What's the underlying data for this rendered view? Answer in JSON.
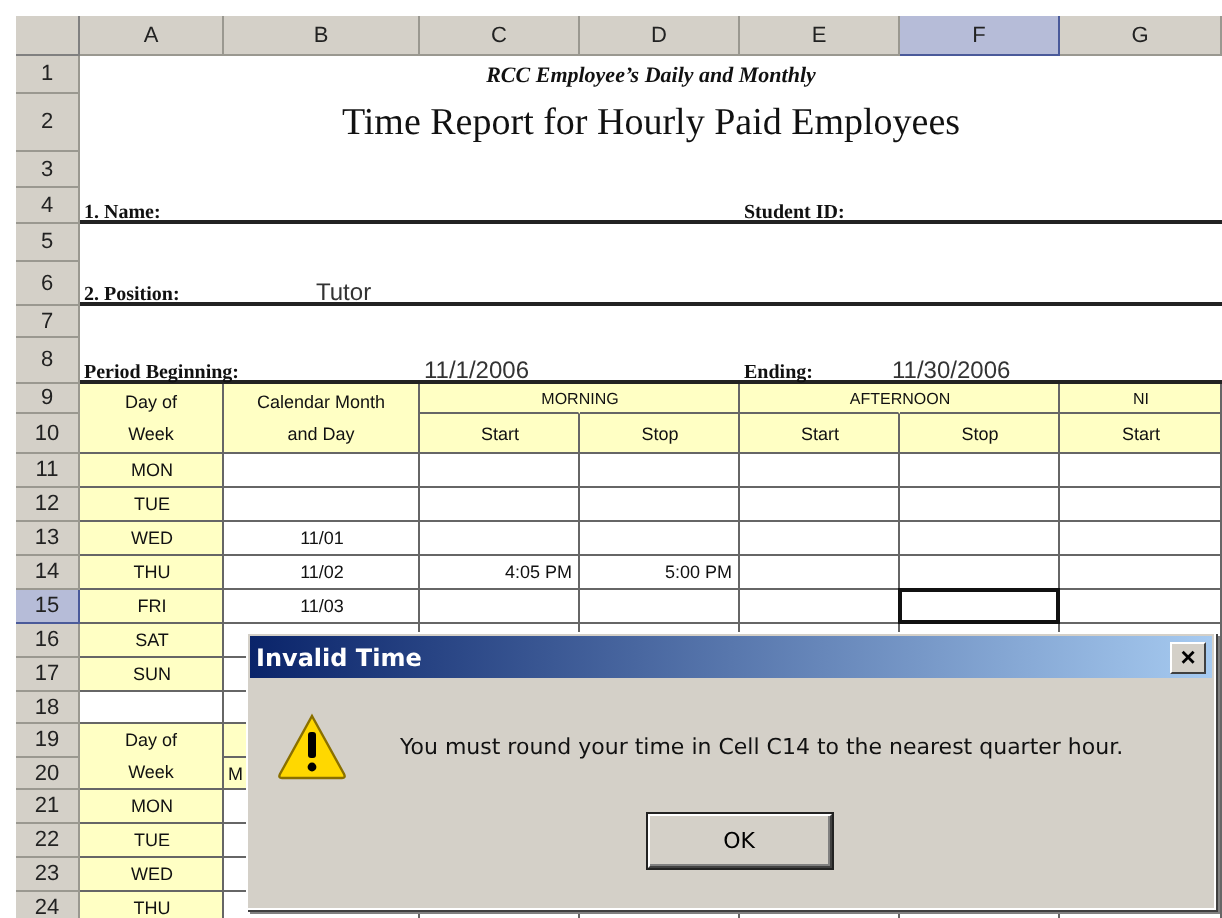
{
  "column_headers": [
    {
      "label": "A",
      "selected": false
    },
    {
      "label": "B",
      "selected": false
    },
    {
      "label": "C",
      "selected": false
    },
    {
      "label": "D",
      "selected": false
    },
    {
      "label": "E",
      "selected": false
    },
    {
      "label": "F",
      "selected": true
    },
    {
      "label": "G",
      "selected": false
    }
  ],
  "row_headers": [
    {
      "label": "1",
      "selected": false
    },
    {
      "label": "2",
      "selected": false
    },
    {
      "label": "3",
      "selected": false
    },
    {
      "label": "4",
      "selected": false
    },
    {
      "label": "5",
      "selected": false
    },
    {
      "label": "6",
      "selected": false
    },
    {
      "label": "7",
      "selected": false
    },
    {
      "label": "8",
      "selected": false
    },
    {
      "label": "9",
      "selected": false
    },
    {
      "label": "10",
      "selected": false
    },
    {
      "label": "11",
      "selected": false
    },
    {
      "label": "12",
      "selected": false
    },
    {
      "label": "13",
      "selected": false
    },
    {
      "label": "14",
      "selected": false
    },
    {
      "label": "15",
      "selected": true
    },
    {
      "label": "16",
      "selected": false
    },
    {
      "label": "17",
      "selected": false
    },
    {
      "label": "18",
      "selected": false
    },
    {
      "label": "19",
      "selected": false
    },
    {
      "label": "20",
      "selected": false
    },
    {
      "label": "21",
      "selected": false
    },
    {
      "label": "22",
      "selected": false
    },
    {
      "label": "23",
      "selected": false
    },
    {
      "label": "24",
      "selected": false
    }
  ],
  "form": {
    "title_line1": "RCC Employee’s Daily and Monthly",
    "title_line2": "Time Report for Hourly Paid Employees",
    "name_label": "1. Name:",
    "student_id_label": "Student ID:",
    "position_label": "2. Position:",
    "position_value": "Tutor",
    "period_beginning_label": "Period Beginning:",
    "period_beginning_value": "11/1/2006",
    "ending_label": "Ending:",
    "ending_value": "11/30/2006"
  },
  "table": {
    "day_header": "Day of Week",
    "date_header": "Calendar Month and Day",
    "groups": [
      "MORNING",
      "AFTERNOON",
      "NI"
    ],
    "subheaders": [
      "Start",
      "Stop",
      "Start",
      "Stop",
      "Start"
    ],
    "days": [
      {
        "day": "MON",
        "times": [
          {
            "selected": false
          },
          {
            "selected": false
          },
          {
            "selected": false
          },
          {
            "selected": false
          },
          {
            "selected": false
          }
        ]
      },
      {
        "day": "TUE",
        "times": [
          {
            "selected": false
          },
          {
            "selected": false
          },
          {
            "selected": false
          },
          {
            "selected": false
          },
          {
            "selected": false
          }
        ]
      },
      {
        "day": "WED",
        "date": "11/01",
        "times": [
          {
            "selected": false
          },
          {
            "selected": false
          },
          {
            "selected": false
          },
          {
            "selected": false
          },
          {
            "selected": false
          }
        ]
      },
      {
        "day": "THU",
        "date": "11/02",
        "times": [
          {
            "text": "4:05 PM",
            "selected": false
          },
          {
            "text": "5:00 PM",
            "selected": false
          },
          {
            "selected": false
          },
          {
            "selected": false
          },
          {
            "selected": false
          }
        ]
      },
      {
        "day": "FRI",
        "date": "11/03",
        "times": [
          {
            "selected": false
          },
          {
            "selected": false
          },
          {
            "selected": false
          },
          {
            "selected": true
          },
          {
            "selected": false
          }
        ]
      },
      {
        "day": "SAT"
      },
      {
        "day": "SUN"
      }
    ]
  },
  "table_2": {
    "day_header": "Day of Week",
    "date_header": "M",
    "days": [
      {
        "day": "MON"
      },
      {
        "day": "TUE"
      },
      {
        "day": "WED"
      },
      {
        "day": "THU"
      }
    ]
  },
  "dialog": {
    "title": "Invalid Time",
    "close": "×",
    "message": "You must round your time in Cell C14 to the nearest quarter hour.",
    "button": "OK"
  }
}
